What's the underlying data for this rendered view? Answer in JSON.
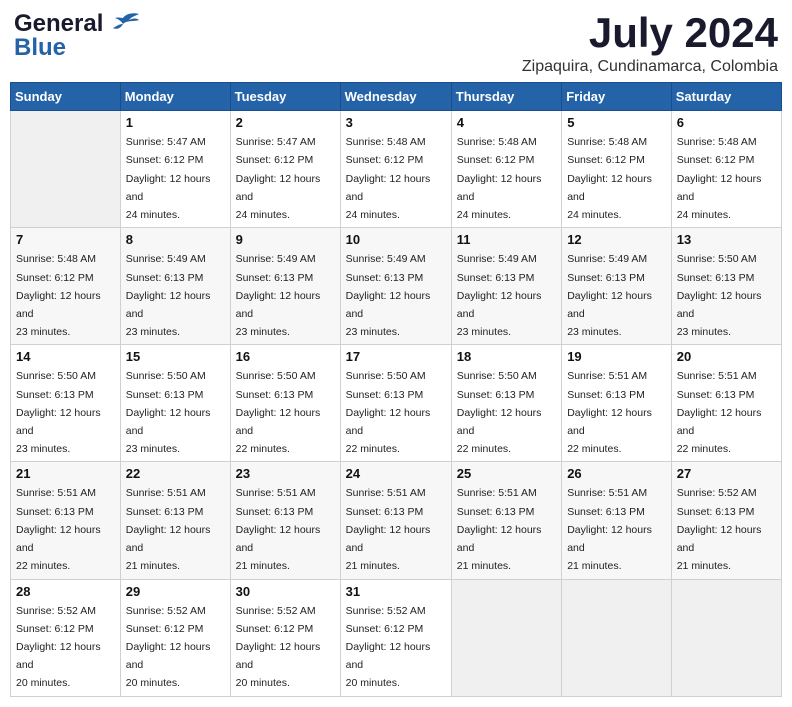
{
  "header": {
    "logo_line1": "General",
    "logo_line2": "Blue",
    "month_year": "July 2024",
    "location": "Zipaquira, Cundinamarca, Colombia"
  },
  "weekdays": [
    "Sunday",
    "Monday",
    "Tuesday",
    "Wednesday",
    "Thursday",
    "Friday",
    "Saturday"
  ],
  "weeks": [
    [
      {
        "day": "",
        "sunrise": "",
        "sunset": "",
        "daylight": ""
      },
      {
        "day": "1",
        "sunrise": "Sunrise: 5:47 AM",
        "sunset": "Sunset: 6:12 PM",
        "daylight": "Daylight: 12 hours and 24 minutes."
      },
      {
        "day": "2",
        "sunrise": "Sunrise: 5:47 AM",
        "sunset": "Sunset: 6:12 PM",
        "daylight": "Daylight: 12 hours and 24 minutes."
      },
      {
        "day": "3",
        "sunrise": "Sunrise: 5:48 AM",
        "sunset": "Sunset: 6:12 PM",
        "daylight": "Daylight: 12 hours and 24 minutes."
      },
      {
        "day": "4",
        "sunrise": "Sunrise: 5:48 AM",
        "sunset": "Sunset: 6:12 PM",
        "daylight": "Daylight: 12 hours and 24 minutes."
      },
      {
        "day": "5",
        "sunrise": "Sunrise: 5:48 AM",
        "sunset": "Sunset: 6:12 PM",
        "daylight": "Daylight: 12 hours and 24 minutes."
      },
      {
        "day": "6",
        "sunrise": "Sunrise: 5:48 AM",
        "sunset": "Sunset: 6:12 PM",
        "daylight": "Daylight: 12 hours and 24 minutes."
      }
    ],
    [
      {
        "day": "7",
        "sunrise": "Sunrise: 5:48 AM",
        "sunset": "Sunset: 6:12 PM",
        "daylight": "Daylight: 12 hours and 23 minutes."
      },
      {
        "day": "8",
        "sunrise": "Sunrise: 5:49 AM",
        "sunset": "Sunset: 6:13 PM",
        "daylight": "Daylight: 12 hours and 23 minutes."
      },
      {
        "day": "9",
        "sunrise": "Sunrise: 5:49 AM",
        "sunset": "Sunset: 6:13 PM",
        "daylight": "Daylight: 12 hours and 23 minutes."
      },
      {
        "day": "10",
        "sunrise": "Sunrise: 5:49 AM",
        "sunset": "Sunset: 6:13 PM",
        "daylight": "Daylight: 12 hours and 23 minutes."
      },
      {
        "day": "11",
        "sunrise": "Sunrise: 5:49 AM",
        "sunset": "Sunset: 6:13 PM",
        "daylight": "Daylight: 12 hours and 23 minutes."
      },
      {
        "day": "12",
        "sunrise": "Sunrise: 5:49 AM",
        "sunset": "Sunset: 6:13 PM",
        "daylight": "Daylight: 12 hours and 23 minutes."
      },
      {
        "day": "13",
        "sunrise": "Sunrise: 5:50 AM",
        "sunset": "Sunset: 6:13 PM",
        "daylight": "Daylight: 12 hours and 23 minutes."
      }
    ],
    [
      {
        "day": "14",
        "sunrise": "Sunrise: 5:50 AM",
        "sunset": "Sunset: 6:13 PM",
        "daylight": "Daylight: 12 hours and 23 minutes."
      },
      {
        "day": "15",
        "sunrise": "Sunrise: 5:50 AM",
        "sunset": "Sunset: 6:13 PM",
        "daylight": "Daylight: 12 hours and 23 minutes."
      },
      {
        "day": "16",
        "sunrise": "Sunrise: 5:50 AM",
        "sunset": "Sunset: 6:13 PM",
        "daylight": "Daylight: 12 hours and 22 minutes."
      },
      {
        "day": "17",
        "sunrise": "Sunrise: 5:50 AM",
        "sunset": "Sunset: 6:13 PM",
        "daylight": "Daylight: 12 hours and 22 minutes."
      },
      {
        "day": "18",
        "sunrise": "Sunrise: 5:50 AM",
        "sunset": "Sunset: 6:13 PM",
        "daylight": "Daylight: 12 hours and 22 minutes."
      },
      {
        "day": "19",
        "sunrise": "Sunrise: 5:51 AM",
        "sunset": "Sunset: 6:13 PM",
        "daylight": "Daylight: 12 hours and 22 minutes."
      },
      {
        "day": "20",
        "sunrise": "Sunrise: 5:51 AM",
        "sunset": "Sunset: 6:13 PM",
        "daylight": "Daylight: 12 hours and 22 minutes."
      }
    ],
    [
      {
        "day": "21",
        "sunrise": "Sunrise: 5:51 AM",
        "sunset": "Sunset: 6:13 PM",
        "daylight": "Daylight: 12 hours and 22 minutes."
      },
      {
        "day": "22",
        "sunrise": "Sunrise: 5:51 AM",
        "sunset": "Sunset: 6:13 PM",
        "daylight": "Daylight: 12 hours and 21 minutes."
      },
      {
        "day": "23",
        "sunrise": "Sunrise: 5:51 AM",
        "sunset": "Sunset: 6:13 PM",
        "daylight": "Daylight: 12 hours and 21 minutes."
      },
      {
        "day": "24",
        "sunrise": "Sunrise: 5:51 AM",
        "sunset": "Sunset: 6:13 PM",
        "daylight": "Daylight: 12 hours and 21 minutes."
      },
      {
        "day": "25",
        "sunrise": "Sunrise: 5:51 AM",
        "sunset": "Sunset: 6:13 PM",
        "daylight": "Daylight: 12 hours and 21 minutes."
      },
      {
        "day": "26",
        "sunrise": "Sunrise: 5:51 AM",
        "sunset": "Sunset: 6:13 PM",
        "daylight": "Daylight: 12 hours and 21 minutes."
      },
      {
        "day": "27",
        "sunrise": "Sunrise: 5:52 AM",
        "sunset": "Sunset: 6:13 PM",
        "daylight": "Daylight: 12 hours and 21 minutes."
      }
    ],
    [
      {
        "day": "28",
        "sunrise": "Sunrise: 5:52 AM",
        "sunset": "Sunset: 6:12 PM",
        "daylight": "Daylight: 12 hours and 20 minutes."
      },
      {
        "day": "29",
        "sunrise": "Sunrise: 5:52 AM",
        "sunset": "Sunset: 6:12 PM",
        "daylight": "Daylight: 12 hours and 20 minutes."
      },
      {
        "day": "30",
        "sunrise": "Sunrise: 5:52 AM",
        "sunset": "Sunset: 6:12 PM",
        "daylight": "Daylight: 12 hours and 20 minutes."
      },
      {
        "day": "31",
        "sunrise": "Sunrise: 5:52 AM",
        "sunset": "Sunset: 6:12 PM",
        "daylight": "Daylight: 12 hours and 20 minutes."
      },
      {
        "day": "",
        "sunrise": "",
        "sunset": "",
        "daylight": ""
      },
      {
        "day": "",
        "sunrise": "",
        "sunset": "",
        "daylight": ""
      },
      {
        "day": "",
        "sunrise": "",
        "sunset": "",
        "daylight": ""
      }
    ]
  ]
}
